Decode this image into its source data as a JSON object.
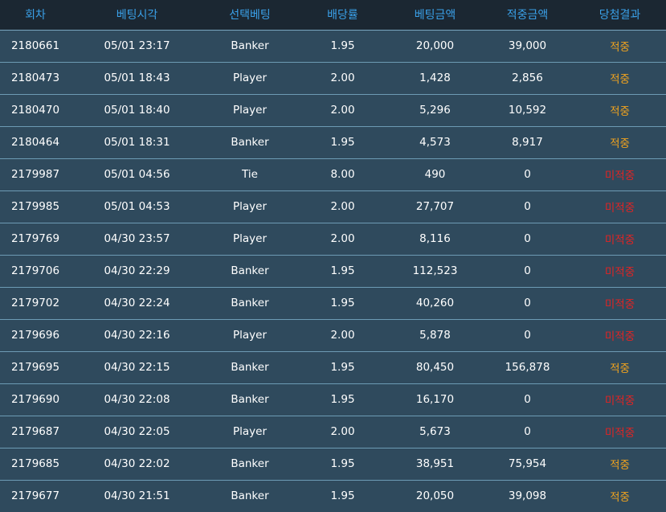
{
  "colors": {
    "header_bg": "#1b2732",
    "header_text": "#3aa0e8",
    "row_bg": "#2f4a5d",
    "row_border": "#6d9bb4",
    "win": "#f0a31e",
    "lose": "#e02424"
  },
  "table": {
    "columns": [
      "회차",
      "베팅시각",
      "선택베팅",
      "배당률",
      "베팅금액",
      "적중금액",
      "당첨결과"
    ],
    "rows": [
      {
        "round": "2180661",
        "time": "05/01 23:17",
        "pick": "Banker",
        "odds": "1.95",
        "bet": "20,000",
        "payout": "39,000",
        "result": "적중",
        "win": true
      },
      {
        "round": "2180473",
        "time": "05/01 18:43",
        "pick": "Player",
        "odds": "2.00",
        "bet": "1,428",
        "payout": "2,856",
        "result": "적중",
        "win": true
      },
      {
        "round": "2180470",
        "time": "05/01 18:40",
        "pick": "Player",
        "odds": "2.00",
        "bet": "5,296",
        "payout": "10,592",
        "result": "적중",
        "win": true
      },
      {
        "round": "2180464",
        "time": "05/01 18:31",
        "pick": "Banker",
        "odds": "1.95",
        "bet": "4,573",
        "payout": "8,917",
        "result": "적중",
        "win": true
      },
      {
        "round": "2179987",
        "time": "05/01 04:56",
        "pick": "Tie",
        "odds": "8.00",
        "bet": "490",
        "payout": "0",
        "result": "미적중",
        "win": false
      },
      {
        "round": "2179985",
        "time": "05/01 04:53",
        "pick": "Player",
        "odds": "2.00",
        "bet": "27,707",
        "payout": "0",
        "result": "미적중",
        "win": false
      },
      {
        "round": "2179769",
        "time": "04/30 23:57",
        "pick": "Player",
        "odds": "2.00",
        "bet": "8,116",
        "payout": "0",
        "result": "미적중",
        "win": false
      },
      {
        "round": "2179706",
        "time": "04/30 22:29",
        "pick": "Banker",
        "odds": "1.95",
        "bet": "112,523",
        "payout": "0",
        "result": "미적중",
        "win": false
      },
      {
        "round": "2179702",
        "time": "04/30 22:24",
        "pick": "Banker",
        "odds": "1.95",
        "bet": "40,260",
        "payout": "0",
        "result": "미적중",
        "win": false
      },
      {
        "round": "2179696",
        "time": "04/30 22:16",
        "pick": "Player",
        "odds": "2.00",
        "bet": "5,878",
        "payout": "0",
        "result": "미적중",
        "win": false
      },
      {
        "round": "2179695",
        "time": "04/30 22:15",
        "pick": "Banker",
        "odds": "1.95",
        "bet": "80,450",
        "payout": "156,878",
        "result": "적중",
        "win": true
      },
      {
        "round": "2179690",
        "time": "04/30 22:08",
        "pick": "Banker",
        "odds": "1.95",
        "bet": "16,170",
        "payout": "0",
        "result": "미적중",
        "win": false
      },
      {
        "round": "2179687",
        "time": "04/30 22:05",
        "pick": "Player",
        "odds": "2.00",
        "bet": "5,673",
        "payout": "0",
        "result": "미적중",
        "win": false
      },
      {
        "round": "2179685",
        "time": "04/30 22:02",
        "pick": "Banker",
        "odds": "1.95",
        "bet": "38,951",
        "payout": "75,954",
        "result": "적중",
        "win": true
      },
      {
        "round": "2179677",
        "time": "04/30 21:51",
        "pick": "Banker",
        "odds": "1.95",
        "bet": "20,050",
        "payout": "39,098",
        "result": "적중",
        "win": true
      }
    ]
  }
}
